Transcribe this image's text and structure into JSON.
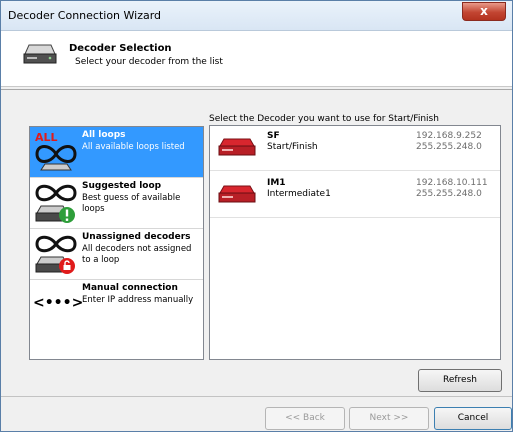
{
  "window": {
    "title": "Decoder Connection Wizard",
    "close_label": "x"
  },
  "header": {
    "title": "Decoder Selection",
    "subtitle": "Select your decoder from the list"
  },
  "instruction": "Select the Decoder you want to use for Start/Finish",
  "loop_options": [
    {
      "title": "All loops",
      "description": "All available loops listed",
      "badge": "ALL",
      "icon": "infinity-icon",
      "selected": true
    },
    {
      "title": "Suggested loop",
      "description": "Best guess of available loops",
      "icon": "infinity-icon"
    },
    {
      "title": "Unassigned decoders",
      "description": "All decoders not assigned to a loop",
      "icon": "infinity-icon"
    },
    {
      "title": "Manual connection",
      "description": "Enter IP address manually",
      "icon": "ip-arrows-icon",
      "symbol": "<•••>"
    }
  ],
  "decoders": [
    {
      "name": "SF",
      "role": "Start/Finish",
      "ip": "192.168.9.252",
      "mask": "255.255.248.0"
    },
    {
      "name": "IM1",
      "role": "Intermediate1",
      "ip": "192.168.10.111",
      "mask": "255.255.248.0"
    }
  ],
  "buttons": {
    "refresh": "Refresh",
    "back": "<< Back",
    "next": "Next >>",
    "cancel": "Cancel"
  },
  "colors": {
    "selection": "#3399ff",
    "decoder_red": "#c8202a",
    "badge_red": "#e01b1b",
    "suggested_green": "#2e9e3a"
  }
}
